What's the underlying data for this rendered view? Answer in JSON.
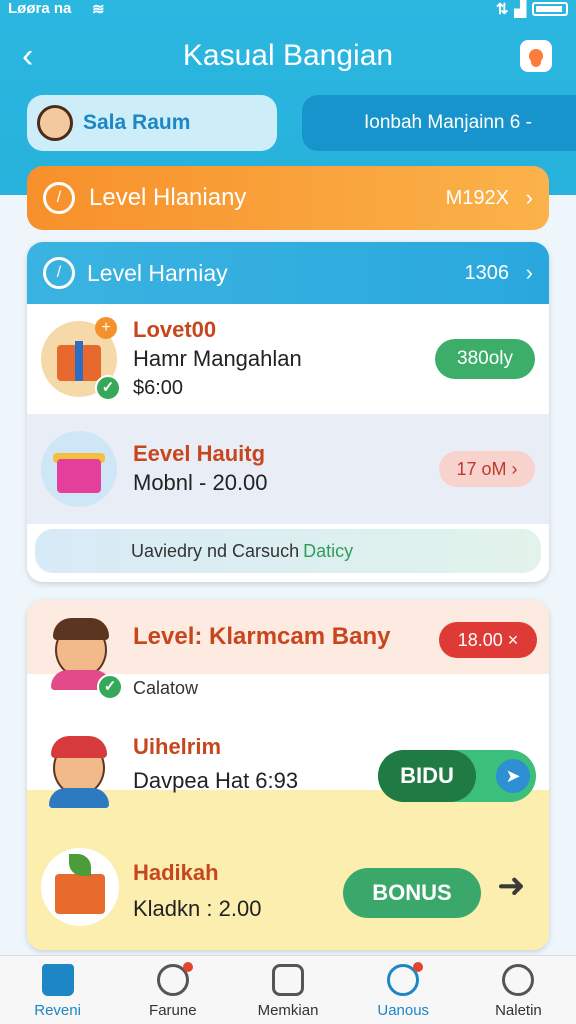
{
  "status_bar": {
    "left": "Løøra na",
    "wifi_icon": "wifi-icon",
    "right_icons": [
      "data-icon",
      "signal-icon",
      "battery-icon"
    ]
  },
  "header": {
    "title": "Kasual Bangian"
  },
  "user": {
    "name": "Sala Raum"
  },
  "info": {
    "text": "Ionbah Manjainn 6 -"
  },
  "banner": {
    "label": "Level Hlaniany",
    "value": "M192X"
  },
  "section1": {
    "header_label": "Level Harniay",
    "header_value": "1306",
    "items": [
      {
        "title": "Lovet00",
        "subtitle": "Hamr Mangahlan",
        "price": "$6:00",
        "action": "380oly"
      },
      {
        "title": "Eevel Hauitg",
        "subtitle": "Mobnl - 20.00",
        "action": "17 oM"
      }
    ],
    "promo": {
      "text": "Uaviedry nd Carsuch",
      "highlight": "Daticy"
    }
  },
  "section2": {
    "title": "Level: Klarmcam Bany",
    "badge": "18.00",
    "badge_icon": "×",
    "sub_label": "Calatow",
    "item2_title": "Uihelrim",
    "item2_sub": "Davpea Hat 6:93",
    "toggle_label": "BIDU",
    "item3_title": "Hadikah",
    "item3_sub": "Kladkn : 2.00",
    "bonus_label": "BONUS"
  },
  "bottom_nav": [
    {
      "label": "Reveni",
      "icon": "home-icon"
    },
    {
      "label": "Farune",
      "icon": "chat-icon"
    },
    {
      "label": "Memkian",
      "icon": "grid-icon"
    },
    {
      "label": "Uanous",
      "icon": "search-icon"
    },
    {
      "label": "Naletin",
      "icon": "user-icon"
    }
  ],
  "colors": {
    "brand": "#2bb7e0",
    "accent_orange": "#f7902a",
    "green": "#3dae6a",
    "red": "#df3b36"
  }
}
